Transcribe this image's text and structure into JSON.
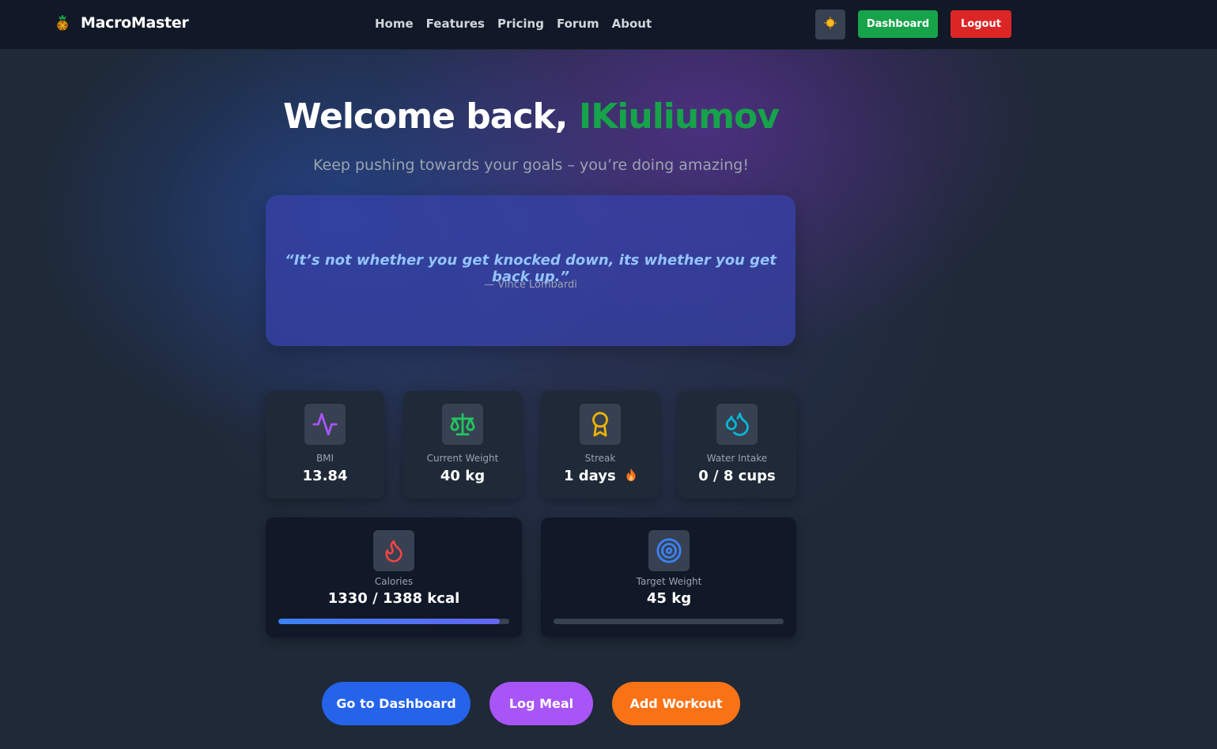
{
  "brand": {
    "name": "MacroMaster",
    "icon": "pineapple-icon"
  },
  "nav": {
    "items": [
      "Home",
      "Features",
      "Pricing",
      "Forum",
      "About"
    ]
  },
  "header": {
    "theme_icon": "sun-icon",
    "dashboard_label": "Dashboard",
    "logout_label": "Logout"
  },
  "hero": {
    "welcome_prefix": "Welcome back,",
    "username": "IKiuliumov",
    "subtitle": "Keep pushing towards your goals – you’re doing amazing!"
  },
  "quote": {
    "text": "“It’s not whether you get knocked down, its whether you get back up.”",
    "author": "— Vince Lombardi"
  },
  "stats": [
    {
      "icon": "activity-icon",
      "label": "BMI",
      "value": "13.84",
      "color": "#a855f7"
    },
    {
      "icon": "scale-icon",
      "label": "Current Weight",
      "value": "40 kg",
      "color": "#22c55e"
    },
    {
      "icon": "award-icon",
      "label": "Streak",
      "value": "1 days",
      "badge": "flame-emoji",
      "color": "#eab308"
    },
    {
      "icon": "droplets-icon",
      "label": "Water Intake",
      "value": "0 / 8 cups",
      "color": "#06b6d4"
    }
  ],
  "calories": {
    "icon": "flame-icon",
    "label": "Calories",
    "value": "1330 / 1388 kcal",
    "progress": 0.958,
    "color": "#ef4444"
  },
  "target": {
    "icon": "target-icon",
    "label": "Target Weight",
    "value": "45 kg",
    "progress": 0,
    "color": "#3b82f6"
  },
  "actions": {
    "dashboard": "Go to Dashboard",
    "log_meal": "Log Meal",
    "add_workout": "Add Workout"
  },
  "colors": {
    "accent_green": "#16a34a",
    "accent_red": "#dc2626",
    "accent_blue": "#2563eb",
    "accent_purple": "#a855f7",
    "accent_orange": "#f97316"
  }
}
